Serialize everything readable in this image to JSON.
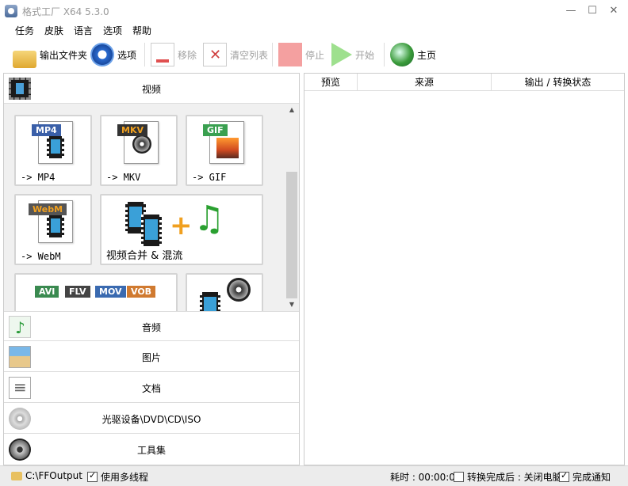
{
  "window": {
    "title": "格式工厂 X64 5.3.0",
    "minimize": "—",
    "maximize": "☐",
    "close": "✕"
  },
  "menu": [
    "任务",
    "皮肤",
    "语言",
    "选项",
    "帮助"
  ],
  "toolbar": {
    "output_folder": "输出文件夹",
    "options": "选项",
    "remove": "移除",
    "clear_list": "清空列表",
    "stop": "停止",
    "start": "开始",
    "home": "主页"
  },
  "categories": {
    "video": "视频",
    "audio": "音频",
    "picture": "图片",
    "document": "文档",
    "optical": "光驱设备\\DVD\\CD\\ISO",
    "tools": "工具集"
  },
  "video_tiles": [
    {
      "badge": "MP4",
      "label": "-> MP4"
    },
    {
      "badge": "MKV",
      "label": "-> MKV"
    },
    {
      "badge": "GIF",
      "label": "-> GIF"
    },
    {
      "badge": "WebM",
      "label": "-> WebM"
    },
    {
      "badge": "",
      "label": "视频合并 & 混流"
    }
  ],
  "partial_tile_badges": [
    "AVI",
    "FLV",
    "MOV",
    "VOB"
  ],
  "task_columns": [
    "预览",
    "来源",
    "输出 / 转换状态"
  ],
  "status": {
    "output_path": "C:\\FFOutput",
    "multithread": "使用多线程",
    "multithread_checked": true,
    "elapsed": "耗时 : 00:00:00",
    "after_done": "转换完成后 : 关闭电脑",
    "after_done_checked": false,
    "notify": "完成通知",
    "notify_checked": true
  },
  "colors": {
    "mp4": "#3a5fa8",
    "mkv": "#333333",
    "mkv_text": "#f0a020",
    "gif": "#3aa050",
    "webm": "#555555",
    "webm_text": "#f0a020",
    "avi": "#3a8a50",
    "flv": "#444444",
    "mov": "#3a6ab0",
    "vob": "#d07a30"
  }
}
